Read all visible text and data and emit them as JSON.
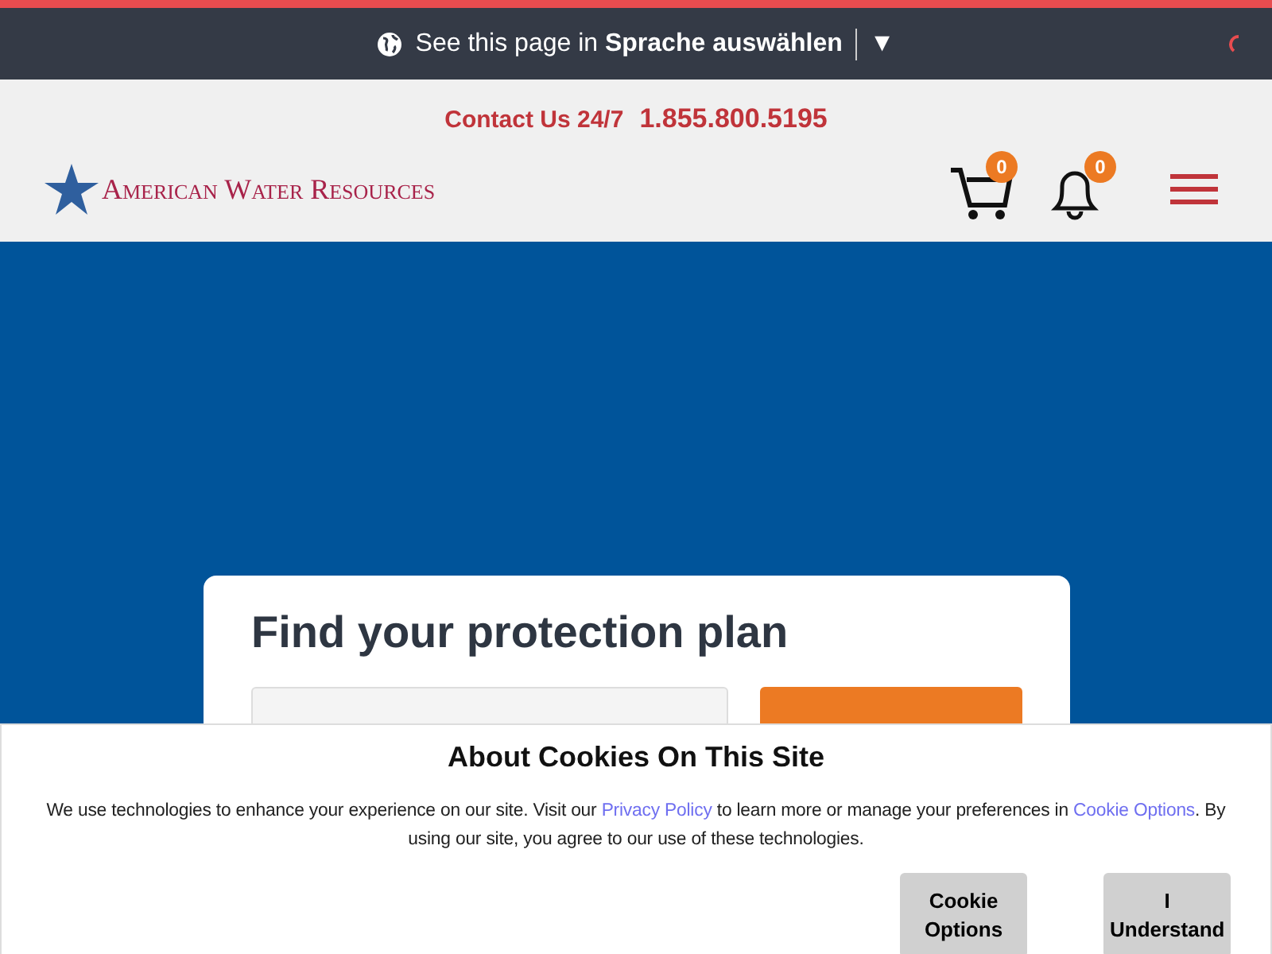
{
  "language_bar": {
    "text": "See this page in **Sprache auswählen**",
    "dropdown_arrow": "▼"
  },
  "header": {
    "contact_label": "Contact Us 24/7",
    "phone": "1.855.800.5195",
    "logo_text": "American Water Resources",
    "cart_count": "0",
    "notification_count": "0"
  },
  "plan_card": {
    "title": "Find your protection plan"
  },
  "cookie_banner": {
    "title": "About Cookies On This Site",
    "text_parts": [
      {
        "kind": "text",
        "text": "We use technologies to enhance your experience on our site. Visit our "
      },
      {
        "kind": "link",
        "text": "Privacy Policy"
      },
      {
        "kind": "text",
        "text": " to learn more or manage your preferences in "
      },
      {
        "kind": "link",
        "text": "Cookie Options"
      },
      {
        "kind": "text",
        "text": ". By using our site, you agree to our use of these technologies."
      }
    ],
    "buttons": [
      "Cookie Options",
      "I Understand"
    ]
  }
}
